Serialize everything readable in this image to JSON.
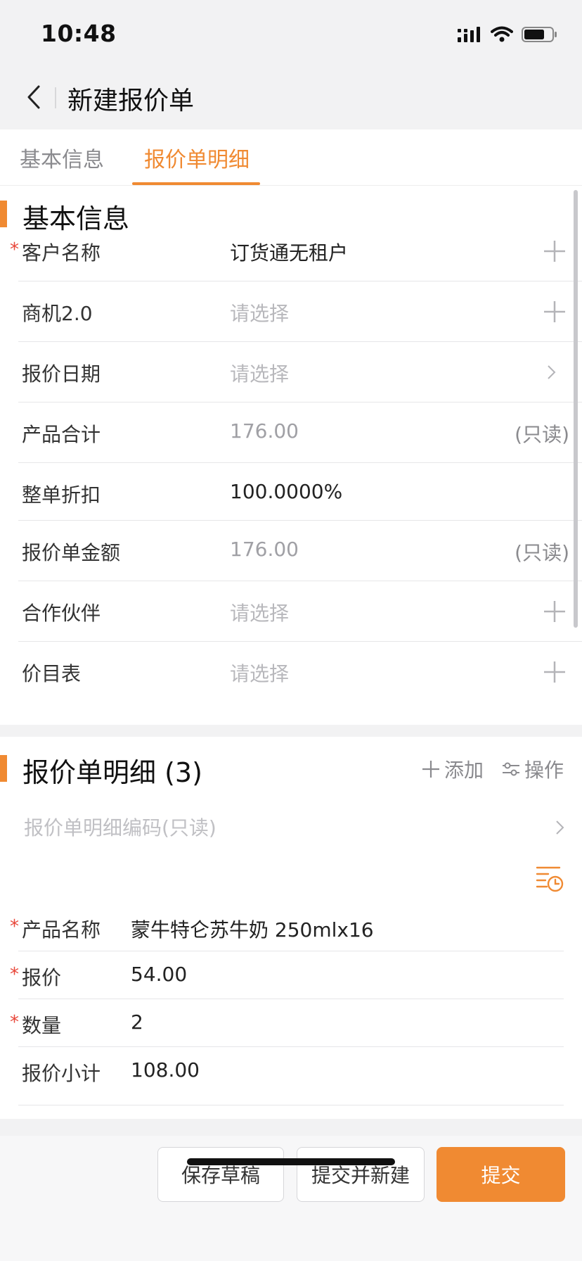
{
  "status": {
    "time": "10:48"
  },
  "nav": {
    "title": "新建报价单"
  },
  "tabs": [
    {
      "label": "基本信息",
      "active": false
    },
    {
      "label": "报价单明细",
      "active": true
    }
  ],
  "basic": {
    "title": "基本信息",
    "rows": [
      {
        "label": "客户名称",
        "required": true,
        "value": "订货通无租户",
        "value_style": "normal",
        "trail": "plus-icon"
      },
      {
        "label": "商机2.0",
        "required": false,
        "value": "请选择",
        "value_style": "placeholder",
        "trail": "plus-icon"
      },
      {
        "label": "报价日期",
        "required": false,
        "value": "请选择",
        "value_style": "placeholder",
        "trail": "chevron-right-icon"
      },
      {
        "label": "产品合计",
        "required": false,
        "value": "176.00",
        "value_style": "readonly",
        "trail_text": "(只读)"
      },
      {
        "label": "整单折扣",
        "required": false,
        "value": "100.0000%",
        "value_style": "normal"
      },
      {
        "label": "报价单金额",
        "required": false,
        "value": "176.00",
        "value_style": "readonly",
        "trail_text": "(只读)"
      },
      {
        "label": "合作伙伴",
        "required": false,
        "value": "请选择",
        "value_style": "placeholder",
        "trail": "plus-icon"
      },
      {
        "label": "价目表",
        "required": false,
        "value": "请选择",
        "value_style": "placeholder",
        "trail": "plus-icon"
      }
    ]
  },
  "details": {
    "title": "报价单明细 (3)",
    "add_label": "添加",
    "ops_label": "操作",
    "code_label": "报价单明细编码(只读)",
    "rows": [
      {
        "label": "产品名称",
        "required": true,
        "value": "蒙牛特仑苏牛奶 250mlx16"
      },
      {
        "label": "报价",
        "required": true,
        "value": "54.00"
      },
      {
        "label": "数量",
        "required": true,
        "value": "2"
      },
      {
        "label": "报价小计",
        "required": false,
        "value": "108.00"
      }
    ]
  },
  "footer": {
    "save_draft": "保存草稿",
    "submit_new": "提交并新建",
    "submit": "提交"
  },
  "colors": {
    "accent": "#f08a32",
    "required": "#e8473a"
  }
}
